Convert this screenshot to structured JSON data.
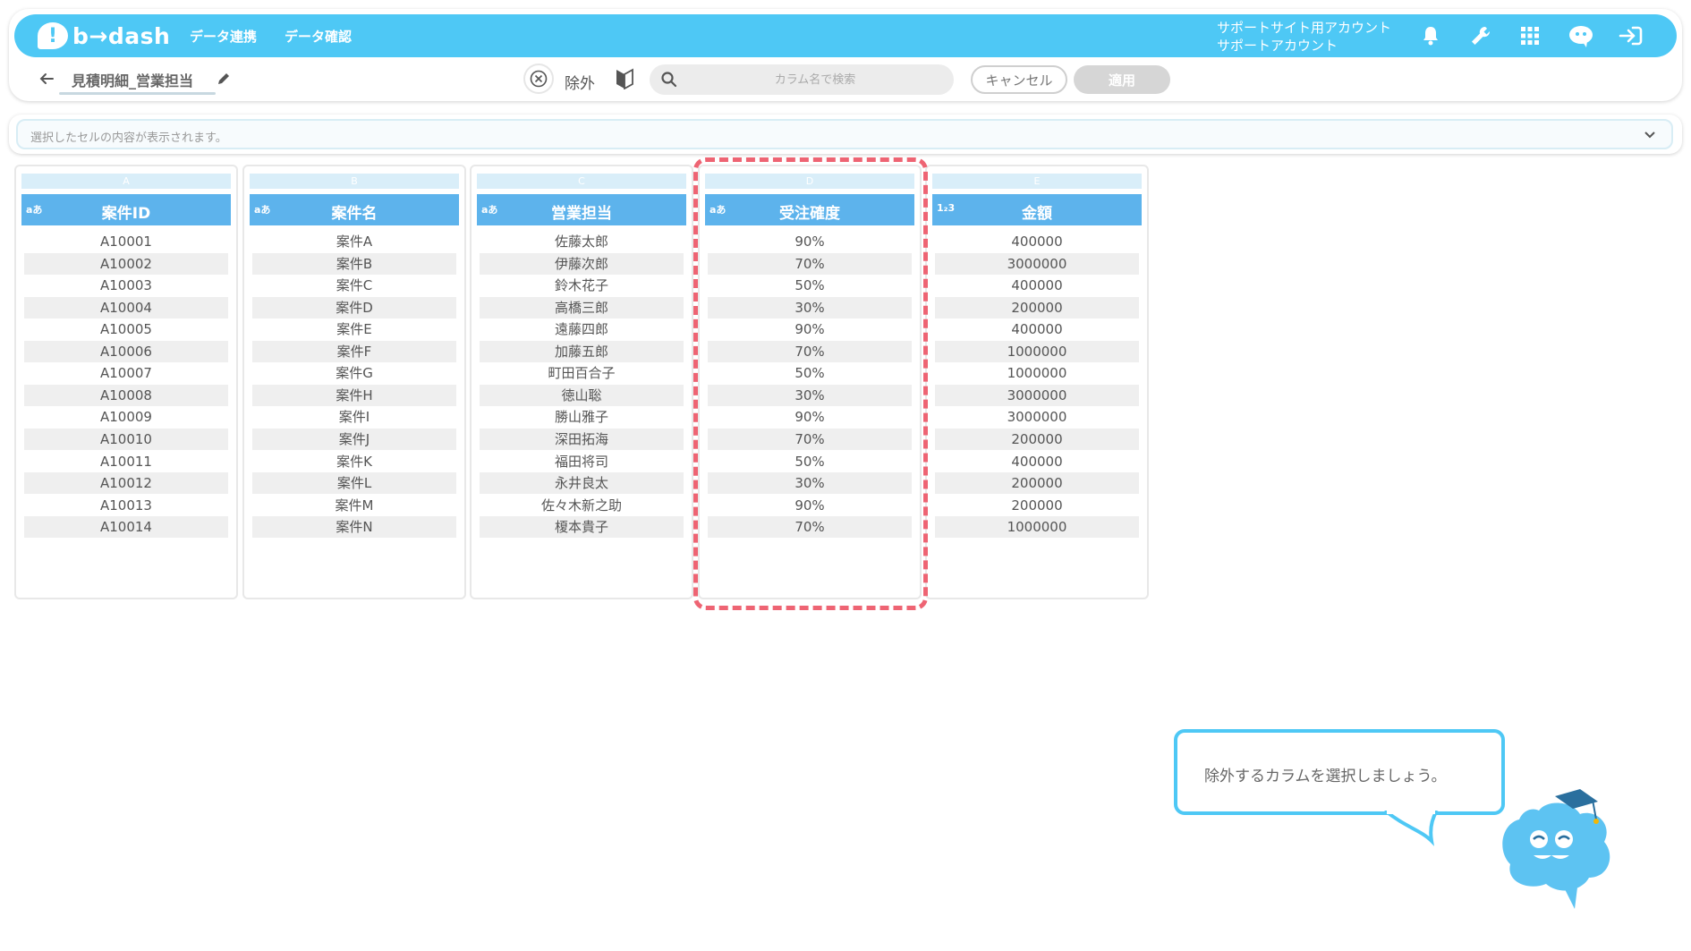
{
  "header": {
    "logo_text": "b→dash",
    "nav": [
      {
        "label": "データ連携"
      },
      {
        "label": "データ確認"
      }
    ],
    "account_line1": "サポートサイト用アカウント",
    "account_line2": "サポートアカウント",
    "icons": [
      "bell-icon",
      "wrench-icon",
      "apps-grid-icon",
      "chat-bot-icon",
      "logout-icon"
    ],
    "brand_color": "#4ec8f5"
  },
  "toolbar": {
    "sheet_title": "見積明細_営業担当",
    "exclude_label": "除外",
    "search_placeholder": "カラム名で検索",
    "cancel_label": "キャンセル",
    "apply_label": "適用"
  },
  "cell_bar": {
    "placeholder": "選択したセルの内容が表示されます。"
  },
  "grid": {
    "columns": [
      {
        "letter": "A",
        "type": "aあ",
        "name": "案件ID",
        "values": [
          "A10001",
          "A10002",
          "A10003",
          "A10004",
          "A10005",
          "A10006",
          "A10007",
          "A10008",
          "A10009",
          "A10010",
          "A10011",
          "A10012",
          "A10013",
          "A10014"
        ]
      },
      {
        "letter": "B",
        "type": "aあ",
        "name": "案件名",
        "values": [
          "案件A",
          "案件B",
          "案件C",
          "案件D",
          "案件E",
          "案件F",
          "案件G",
          "案件H",
          "案件I",
          "案件J",
          "案件K",
          "案件L",
          "案件M",
          "案件N"
        ]
      },
      {
        "letter": "C",
        "type": "aあ",
        "name": "営業担当",
        "values": [
          "佐藤太郎",
          "伊藤次郎",
          "鈴木花子",
          "高橋三郎",
          "遠藤四郎",
          "加藤五郎",
          "町田百合子",
          "徳山聡",
          "勝山雅子",
          "深田拓海",
          "福田将司",
          "永井良太",
          "佐々木新之助",
          "榎本貴子"
        ]
      },
      {
        "letter": "D",
        "type": "aあ",
        "name": "受注確度",
        "values": [
          "90%",
          "70%",
          "50%",
          "30%",
          "90%",
          "70%",
          "50%",
          "30%",
          "90%",
          "70%",
          "50%",
          "30%",
          "90%",
          "70%"
        ]
      },
      {
        "letter": "E",
        "type": "1₂3",
        "name": "金額",
        "values": [
          "400000",
          "3000000",
          "400000",
          "200000",
          "400000",
          "1000000",
          "1000000",
          "3000000",
          "3000000",
          "200000",
          "400000",
          "200000",
          "200000",
          "1000000"
        ]
      }
    ],
    "highlighted_column": "D",
    "header_color": "#5db3ec",
    "highlight_color": "#ee6473"
  },
  "tooltip": {
    "text": "除外するカラムを選択しましょう。"
  }
}
